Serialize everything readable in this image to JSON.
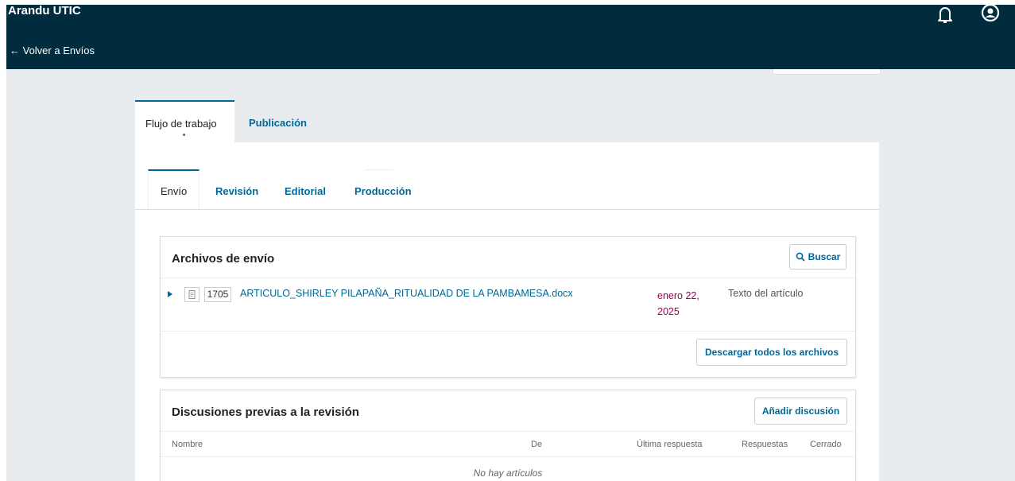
{
  "header": {
    "app_title": "Arandu UTIC",
    "back_link": "← Volver a Envíos",
    "icons": [
      "bell-icon",
      "user-icon"
    ],
    "bg_color": "#002c3e"
  },
  "main_tabs": [
    {
      "label": "Flujo de trabajo",
      "active": true
    },
    {
      "label": "Publicación",
      "active": false
    }
  ],
  "stage_tabs": [
    {
      "label": "Envío",
      "active": true
    },
    {
      "label": "Revisión",
      "active": false
    },
    {
      "label": "Editorial",
      "active": false
    },
    {
      "label": "Producción",
      "active": false
    }
  ],
  "submission_files": {
    "title": "Archivos de envío",
    "search_label": "Buscar",
    "files": [
      {
        "id": "1705",
        "name": "ARTICULO_SHIRLEY PILAPAÑA_RITUALIDAD DE LA PAMBAMESA.docx",
        "date_line1": "enero 22,",
        "date_line2": "2025",
        "type": "Texto del artículo"
      }
    ],
    "download_all_label": "Descargar todos los archivos"
  },
  "discussions": {
    "title": "Discusiones previas a la revisión",
    "add_label": "Añadir discusión",
    "columns": [
      "Nombre",
      "De",
      "Última respuesta",
      "Respuestas",
      "Cerrado"
    ],
    "empty_text": "No hay artículos"
  },
  "colors": {
    "accent": "#006798",
    "date": "#a0005a",
    "background": "#e9ecee"
  }
}
